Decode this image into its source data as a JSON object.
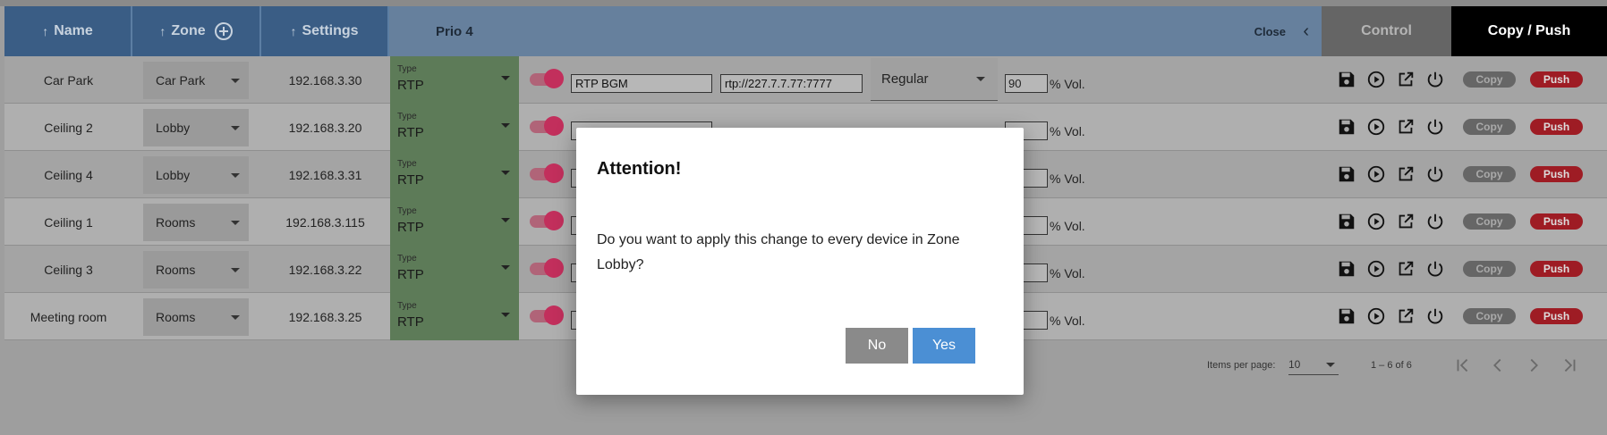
{
  "header": {
    "name": "Name",
    "zone": "Zone",
    "settings": "Settings",
    "prio": "Prio 4",
    "close": "Close",
    "control": "Control",
    "copy_push": "Copy / Push",
    "sort_arrow": "↑"
  },
  "type_label": "Type",
  "vol_suffix": "% Vol.",
  "copy_label": "Copy",
  "push_label": "Push",
  "first_row": {
    "source": "RTP BGM",
    "url": "rtp://227.7.7.77:7777",
    "mode": "Regular"
  },
  "rows": [
    {
      "name": "Car Park",
      "zone": "Car Park",
      "ip": "192.168.3.30",
      "type": "RTP",
      "vol": "90"
    },
    {
      "name": "Ceiling 2",
      "zone": "Lobby",
      "ip": "192.168.3.20",
      "type": "RTP",
      "vol": ""
    },
    {
      "name": "Ceiling 4",
      "zone": "Lobby",
      "ip": "192.168.3.31",
      "type": "RTP",
      "vol": ""
    },
    {
      "name": "Ceiling 1",
      "zone": "Rooms",
      "ip": "192.168.3.115",
      "type": "RTP",
      "vol": ""
    },
    {
      "name": "Ceiling 3",
      "zone": "Rooms",
      "ip": "192.168.3.22",
      "type": "RTP",
      "vol": ""
    },
    {
      "name": "Meeting room",
      "zone": "Rooms",
      "ip": "192.168.3.25",
      "type": "RTP",
      "vol": ""
    }
  ],
  "paginator": {
    "label": "Items per page:",
    "per_page": "10",
    "range": "1 – 6 of 6"
  },
  "dialog": {
    "title": "Attention!",
    "message": "Do you want to apply this change to every device in Zone Lobby?",
    "no": "No",
    "yes": "Yes"
  },
  "colors": {
    "header_blue": "#3a5d85",
    "type_green": "#5d7b58",
    "toggle_pink": "#c22f5c",
    "push_red": "#9e1c24",
    "yes_blue": "#4b8fd4"
  }
}
